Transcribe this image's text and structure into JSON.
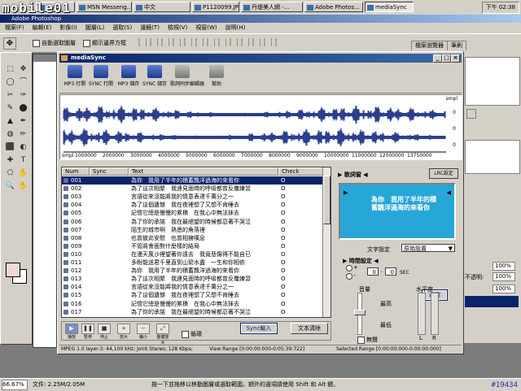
{
  "watermark": "mobile01",
  "taskbar": {
    "buttons": [
      {
        "label": "D A..."
      },
      {
        "label": "MSN Messeng..."
      },
      {
        "label": "中文"
      },
      {
        "label": "P1120099.JPG..."
      },
      {
        "label": "丹堤美人網 -..."
      },
      {
        "label": "Adobe Photos..."
      },
      {
        "label": "mediaSync"
      }
    ],
    "clock": "下午 02:38"
  },
  "photoshop": {
    "title": "Adobe Photoshop",
    "menu": [
      "檔案(F)",
      "編輯(E)",
      "影像(I)",
      "圖層(L)",
      "選取(S)",
      "濾鏡(T)",
      "檢視(V)",
      "視窗(W)",
      "說明(H)"
    ],
    "options": {
      "auto_select": "自動選取圖層",
      "show_bounds": "顯示邊界方框"
    },
    "panel_tabs": [
      "檔案瀏覽器",
      "筆刷"
    ],
    "right_fields": {
      "opacity_label": "不透明:",
      "opacity_value": "100%",
      "fill_value": "100%",
      "fill_value2": "100%"
    },
    "status": {
      "zoom": "66.67%",
      "doc": "文件: 2.25M/2.05M",
      "hint": "按一下並拖移以移動圖層或選取範圍。額外的選項請使用 Shift 和 Alt 鍵。"
    }
  },
  "mediasync": {
    "title": "mediaSync",
    "toolbar": [
      {
        "icon": "mp3-open-icon",
        "label": "MP3 打開"
      },
      {
        "icon": "sync-open-icon",
        "label": "SYNC 打開"
      },
      {
        "icon": "mp3-save-icon",
        "label": "MP3 儲存"
      },
      {
        "icon": "sync-save-icon",
        "label": "SYNC 儲存"
      },
      {
        "icon": "lyrics-editor-icon",
        "label": "歌詞同步編輯器"
      },
      {
        "icon": "help-icon",
        "label": "幫助"
      }
    ],
    "wave": {
      "left_label": "smpl",
      "scale_label": "smpl",
      "ticks": [
        "1000000",
        "2000000",
        "3000000",
        "4000000",
        "5000000",
        "6000000",
        "7000000",
        "8000000",
        "9000000",
        "10000000",
        "11000000",
        "12000000",
        "13750000"
      ],
      "right_values": [
        "0",
        "0",
        "0"
      ]
    },
    "table": {
      "headers": [
        "Num",
        "Sync",
        "Text",
        "Check"
      ],
      "rows": [
        {
          "num": "001",
          "text": "為你　我用了半年的積蓄飄洋過海的來看你",
          "check": "O"
        },
        {
          "num": "002",
          "text": "為了這次相聚　我連見面時的呼吸都曾反覆練習",
          "check": "O"
        },
        {
          "num": "003",
          "text": "言語從來沒能將我的情意表達千萬分之一",
          "check": "O"
        },
        {
          "num": "004",
          "text": "為了這個遺憾　我在夜裡想了又想不肯睡去",
          "check": "O"
        },
        {
          "num": "005",
          "text": "記憶它總是慢慢的累積　在我心中無法抹去",
          "check": "O"
        },
        {
          "num": "006",
          "text": "為了你的承諾　我在最絕望的時候都忍著不哭泣",
          "check": "O"
        },
        {
          "num": "007",
          "text": "陌生的城市啊　熟悉的角落裡",
          "check": "O"
        },
        {
          "num": "008",
          "text": "也曾彼此安慰　也曾相擁嘆息",
          "check": "O"
        },
        {
          "num": "009",
          "text": "不管將會面對什麼樣的結局",
          "check": "O"
        },
        {
          "num": "010",
          "text": "在漫天風沙裡望著你遠去　我竟悲傷得不能自已",
          "check": "O"
        },
        {
          "num": "011",
          "text": "多盼能送君千里直到山窮水盡　一生和你相依",
          "check": "O"
        },
        {
          "num": "012",
          "text": "為你　我用了半年的積蓄飄洋過海的來看你",
          "check": "O"
        },
        {
          "num": "013",
          "text": "為了這次相聚　我連見面時的呼吸都曾反覆練習",
          "check": "O"
        },
        {
          "num": "014",
          "text": "言語從來沒能將我的情意表達千萬分之一",
          "check": "O"
        },
        {
          "num": "015",
          "text": "為了這個遺憾　我在夜裡想了又想不肯睡去",
          "check": "O"
        },
        {
          "num": "016",
          "text": "記憶它總是慢慢的累積　在我心中無法抹去",
          "check": "O"
        },
        {
          "num": "017",
          "text": "為了你的承諾　我在最絕望的時候都忍著不哭泣",
          "check": "O"
        }
      ]
    },
    "lyrics_panel": {
      "label": "歌詞窗",
      "lrc_button": "LRC設定",
      "preview_text": "為你　我用了半年的積蓄飄洋過海的來看你",
      "text_setting_label": "文字設定",
      "text_setting_value": "原始設置"
    },
    "time_panel": {
      "label": "時間設定",
      "sec_a": "0",
      "sec_b": "0",
      "unit": "SEC",
      "apply": "運用",
      "sign_plus": "+",
      "sign_minus": "-"
    },
    "volume": {
      "label": "音量",
      "max": "最高",
      "min": "最低",
      "mute": "無聲",
      "level_label": "水平度",
      "l": "L",
      "r": "R"
    },
    "player": {
      "buttons": [
        "播放",
        "暫停",
        "停止",
        "放大",
        "縮小",
        "整體放大"
      ],
      "repeat_label": "循環",
      "sync_input": "Sync輸入",
      "text_clear": "文本清除"
    },
    "status": {
      "format": "MPEG 1.0 layer-3: 44,100 kHz; Joint Stereo; 128 Kbps;",
      "view_range": "View Range [0:00:00:000-0:05:39:722]",
      "selected_range": "Selected Range [0:00:00:000-0:00:00:000]"
    }
  },
  "bottom_mark": "#19434"
}
